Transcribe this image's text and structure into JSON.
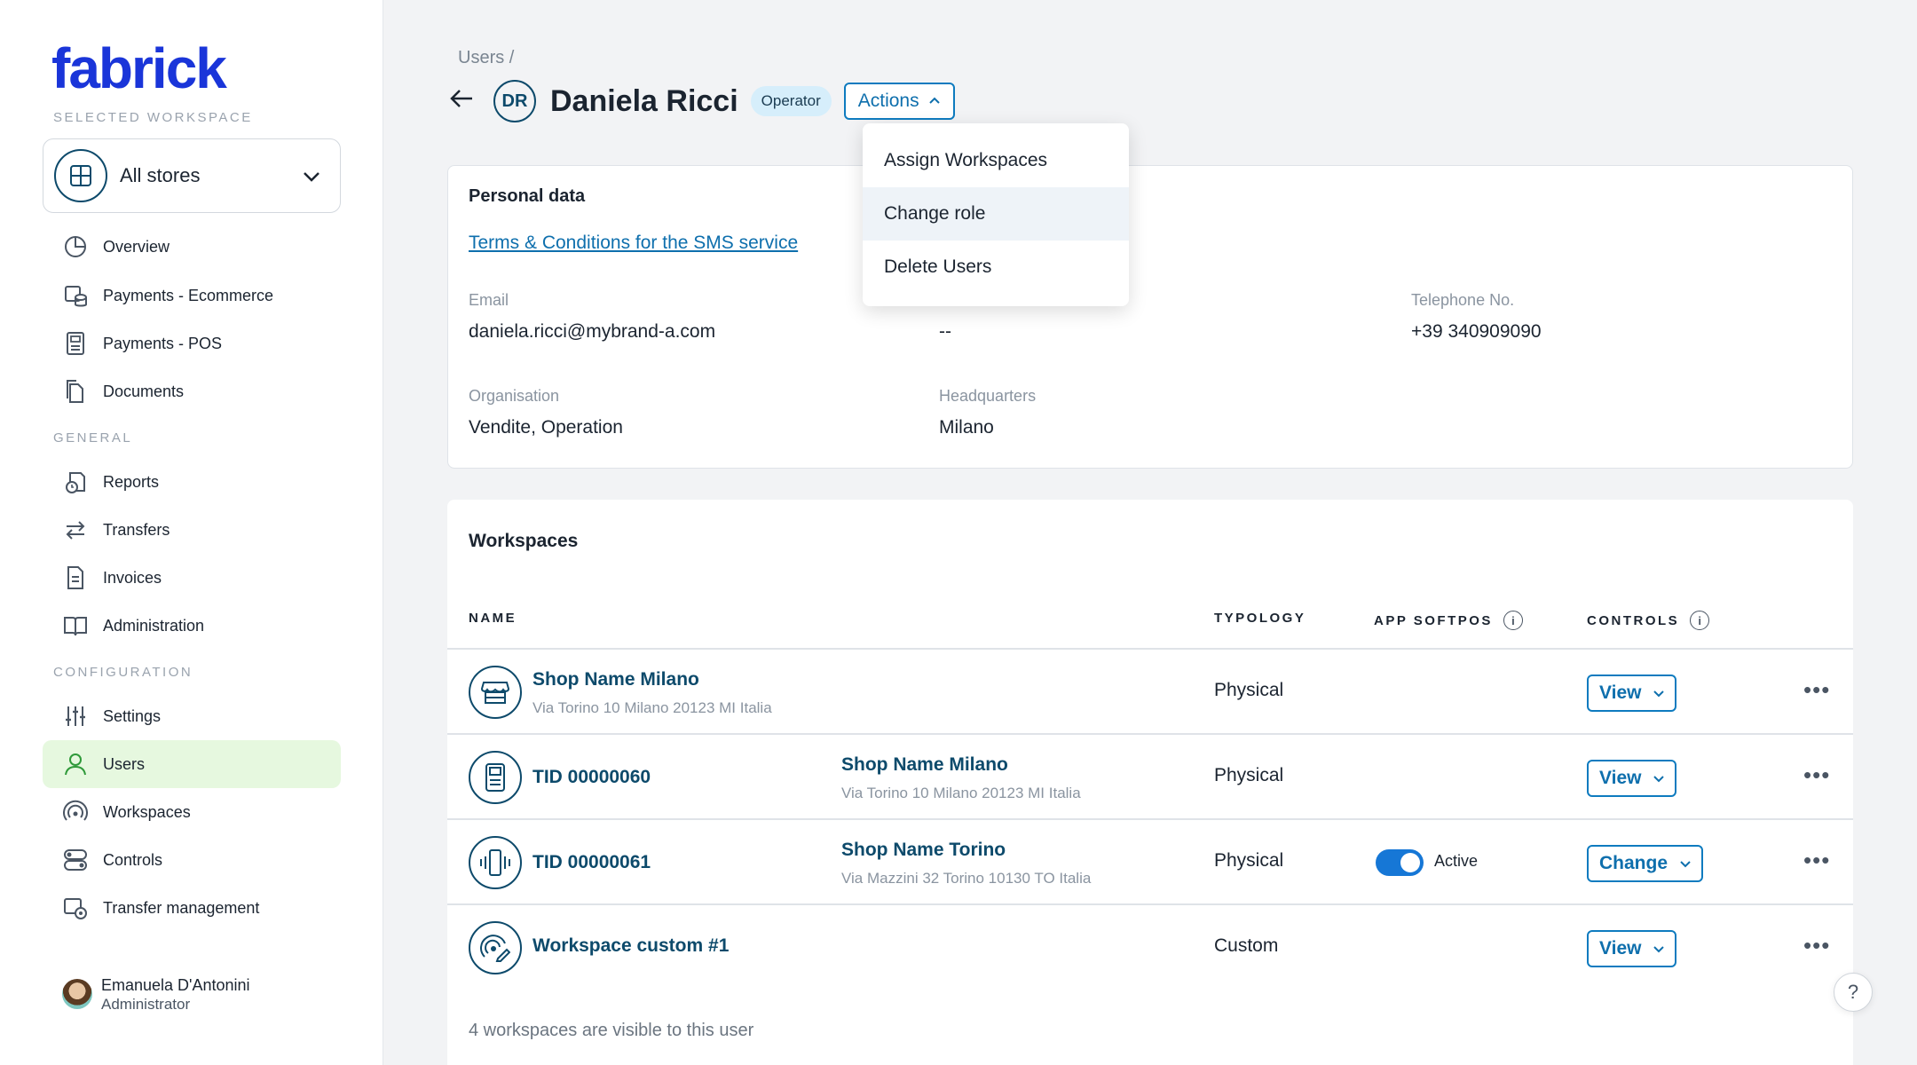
{
  "brand": {
    "logo": "fabrick"
  },
  "sidebar": {
    "selected_workspace_label": "SELECTED WORKSPACE",
    "workspace_select": {
      "value": "All stores",
      "icon": "store-grid-icon"
    },
    "items_main": [
      {
        "label": "Overview",
        "icon": "pie-chart-icon"
      },
      {
        "label": "Payments - Ecommerce",
        "icon": "coins-icon"
      },
      {
        "label": "Payments - POS",
        "icon": "pos-terminal-icon"
      },
      {
        "label": "Documents",
        "icon": "documents-icon"
      }
    ],
    "general_label": "GENERAL",
    "items_general": [
      {
        "label": "Reports",
        "icon": "report-clock-icon"
      },
      {
        "label": "Transfers",
        "icon": "arrows-exchange-icon"
      },
      {
        "label": "Invoices",
        "icon": "invoice-icon"
      },
      {
        "label": "Administration",
        "icon": "book-icon"
      }
    ],
    "configuration_label": "CONFIGURATION",
    "items_config": [
      {
        "label": "Settings",
        "icon": "sliders-icon"
      },
      {
        "label": "Users",
        "icon": "user-icon",
        "active": true
      },
      {
        "label": "Workspaces",
        "icon": "signal-icon"
      },
      {
        "label": "Controls",
        "icon": "toggles-icon"
      },
      {
        "label": "Transfer management",
        "icon": "transfer-settings-icon"
      }
    ],
    "user": {
      "name": "Emanuela D'Antonini",
      "role": "Administrator"
    }
  },
  "header": {
    "breadcrumb": "Users /",
    "initials": "DR",
    "name": "Daniela Ricci",
    "role_badge": "Operator",
    "actions_label": "Actions"
  },
  "actions_menu": {
    "items": [
      "Assign Workspaces",
      "Change role",
      "Delete Users"
    ],
    "highlighted": "Change role"
  },
  "personal_data": {
    "title": "Personal data",
    "terms_link": "Terms & Conditions for the SMS service",
    "email_label": "Email",
    "email": "daniela.ricci@mybrand-a.com",
    "middle_value": "--",
    "telephone_label": "Telephone No.",
    "telephone": "+39 340909090",
    "organisation_label": "Organisation",
    "organisation": "Vendite, Operation",
    "headquarters_label": "Headquarters",
    "headquarters": "Milano"
  },
  "workspaces": {
    "title": "Workspaces",
    "columns": {
      "name": "NAME",
      "typology": "TYPOLOGY",
      "softpos": "APP SOFTPOS",
      "controls": "CONTROLS"
    },
    "rows": [
      {
        "icon": "store-icon",
        "name": "Shop Name Milano",
        "sub": "Via Torino 10 Milano 20123 MI Italia",
        "store": "",
        "store_address": "",
        "typology": "Physical",
        "softpos": "",
        "control": "View"
      },
      {
        "icon": "pos-terminal-icon",
        "name": "TID 00000060",
        "sub": "",
        "store": "Shop Name Milano",
        "store_address": "Via Torino 10 Milano 20123 MI Italia",
        "typology": "Physical",
        "softpos": "",
        "control": "View"
      },
      {
        "icon": "vibrating-phone-icon",
        "name": "TID 00000061",
        "sub": "",
        "store": "Shop Name Torino",
        "store_address": "Via Mazzini 32 Torino 10130 TO Italia",
        "typology": "Physical",
        "softpos": "Active",
        "control": "Change"
      },
      {
        "icon": "custom-signal-icon",
        "name": "Workspace custom #1",
        "sub": "",
        "store": "",
        "store_address": "",
        "typology": "Custom",
        "softpos": "",
        "control": "View"
      }
    ],
    "footnote": "4 workspaces are visible to this user"
  }
}
